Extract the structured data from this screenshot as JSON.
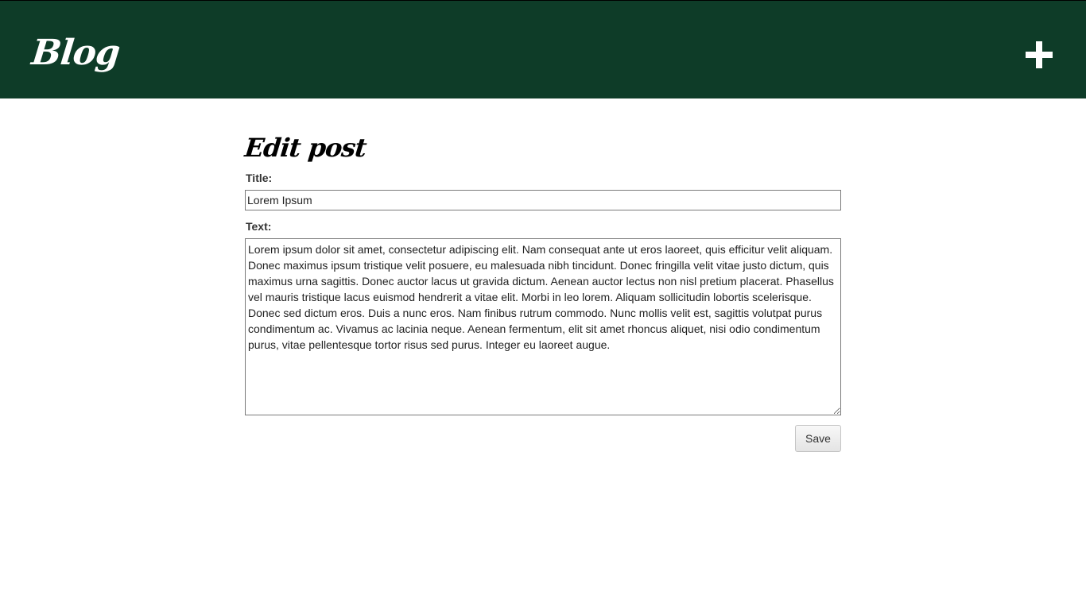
{
  "header": {
    "brand": "Blog",
    "add_icon": "plus-icon",
    "background_color": "#0e3c28"
  },
  "main": {
    "heading": "Edit post",
    "form": {
      "title_label": "Title:",
      "title_value": "Lorem Ipsum",
      "text_label": "Text:",
      "text_value": "Lorem ipsum dolor sit amet, consectetur adipiscing elit. Nam consequat ante ut eros laoreet, quis efficitur velit aliquam. Donec maximus ipsum tristique velit posuere, eu malesuada nibh tincidunt. Donec fringilla velit vitae justo dictum, quis maximus urna sagittis. Donec auctor lacus ut gravida dictum. Aenean auctor lectus non nisl pretium placerat. Phasellus vel mauris tristique lacus euismod hendrerit a vitae elit. Morbi in leo lorem. Aliquam sollicitudin lobortis scelerisque. Donec sed dictum eros. Duis a nunc eros. Nam finibus rutrum commodo. Nunc mollis velit est, sagittis volutpat purus condimentum ac. Vivamus ac lacinia neque. Aenean fermentum, elit sit amet rhoncus aliquet, nisi odio condimentum purus, vitae pellentesque tortor risus sed purus. Integer eu laoreet augue.",
      "save_label": "Save"
    }
  }
}
